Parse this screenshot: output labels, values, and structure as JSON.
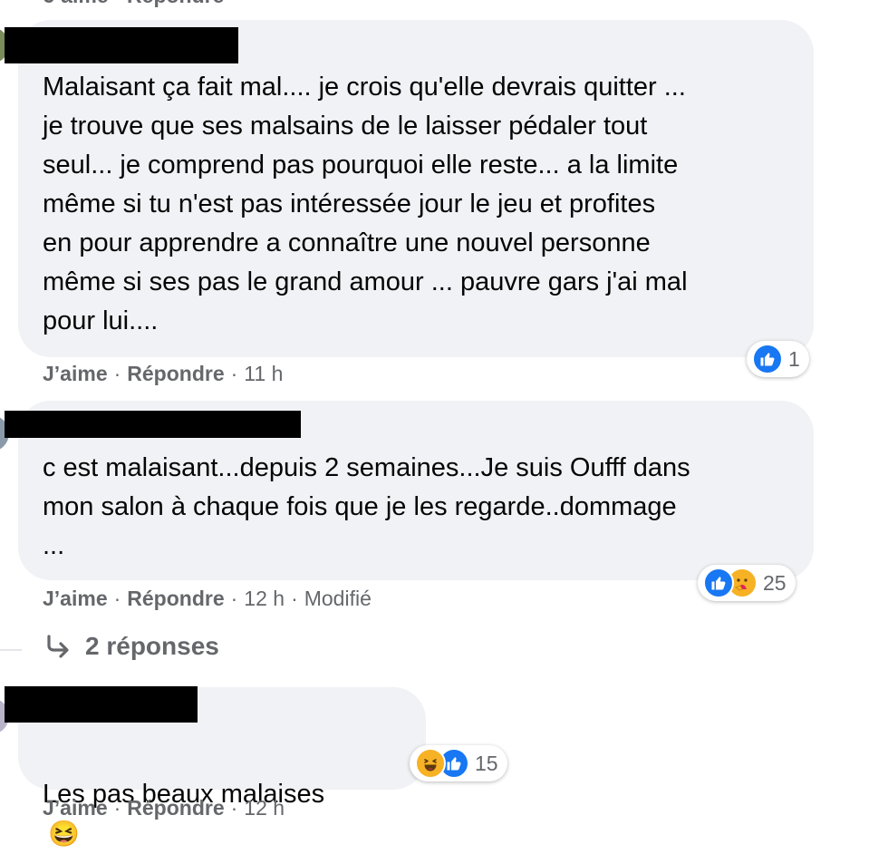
{
  "comments": [
    {
      "text": "Malaisant ça fait mal.... je crois qu'elle devrais quitter ...\nje trouve que ses malsains de le laisser pédaler tout\nseul... je comprend pas pourquoi elle reste... a la limite\nmême si tu n'est pas intéressée jour le jeu et profites\nen pour apprendre a connaître une nouvel personne\nmême si ses pas le grand amour ... pauvre gars j'ai mal\npour lui....",
      "like_label": "J’aime",
      "reply_label": "Répondre",
      "time": "11 h",
      "reaction_count": "1"
    },
    {
      "text": "c est malaisant...depuis 2 semaines...Je suis Oufff dans\nmon salon à chaque fois que je les regarde..dommage\n...",
      "like_label": "J’aime",
      "reply_label": "Répondre",
      "time": "12 h",
      "edited": "Modifié",
      "reaction_count": "25",
      "replies_label": "2 réponses"
    },
    {
      "text": "Les pas beaux malaises",
      "emoji": "😆",
      "like_label": "J’aime",
      "reply_label": "Répondre",
      "time": "12 h",
      "reaction_count": "15"
    }
  ],
  "reaction_icons": [
    "like-icon",
    "care-icon",
    "haha-icon"
  ],
  "colors": {
    "bubble": "#f0f2f5",
    "meta": "#65676b",
    "like_blue": "#1877f2",
    "text": "#050505"
  }
}
